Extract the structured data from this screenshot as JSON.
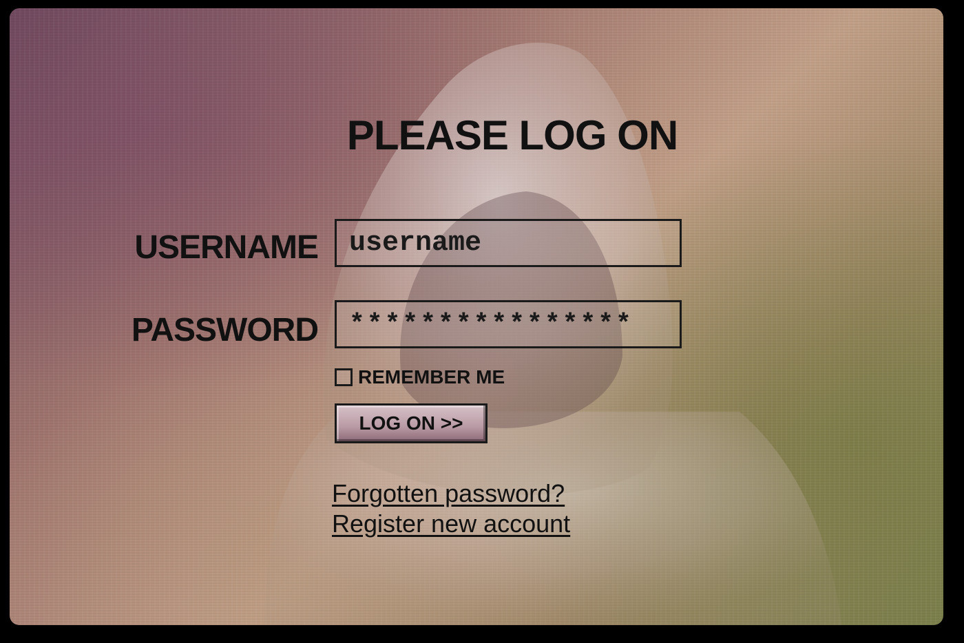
{
  "login": {
    "title": "PLEASE LOG ON",
    "username_label": "USERNAME",
    "username_value": "username",
    "password_label": "PASSWORD",
    "password_value": "****************",
    "remember_label": "REMEMBER ME",
    "remember_checked": false,
    "logon_button": "LOG ON >>",
    "forgot_link": "Forgotten password?",
    "register_link": "Register new account"
  },
  "colors": {
    "text": "#111111",
    "border": "#1a1a1a",
    "background_tint_top": "#6e4a5e",
    "background_tint_bottom": "#7f8250"
  },
  "background": {
    "image_subject": "hooded-figure"
  }
}
